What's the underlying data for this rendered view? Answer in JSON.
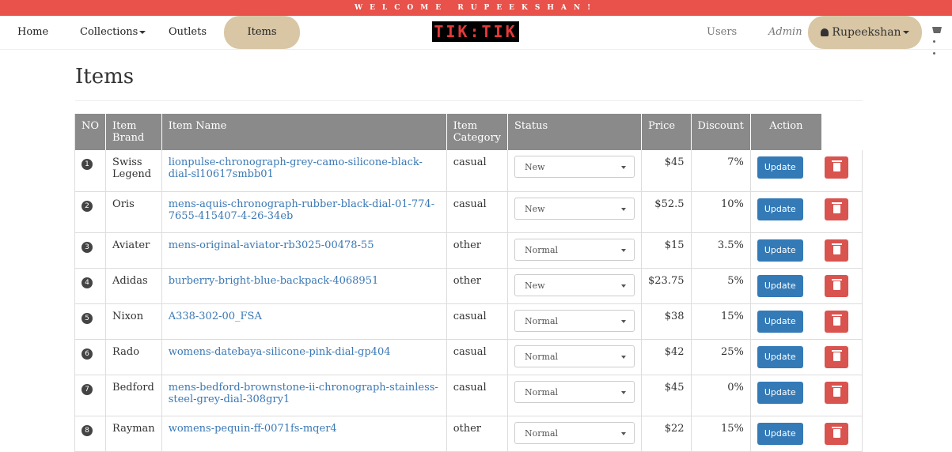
{
  "banner": {
    "text": "WELCOME RUPEEKSHAN!"
  },
  "nav": {
    "home": "Home",
    "collections": "Collections",
    "outlets": "Outlets",
    "items": "Items",
    "logo": "TIK:TIK",
    "users": "Users",
    "admin": "Admin",
    "user_name": "Rupeekshan"
  },
  "page": {
    "title": "Items"
  },
  "table": {
    "headers": {
      "no": "NO",
      "brand": "Item Brand",
      "name": "Item Name",
      "category": "Item Category",
      "status": "Status",
      "price": "Price",
      "discount": "Discount",
      "action": "Action"
    },
    "update_label": "Update",
    "rows": [
      {
        "no": "1",
        "brand": "Swiss Legend",
        "name": "lionpulse-chronograph-grey-camo-silicone-black-dial-sl10617smbb01",
        "category": "casual",
        "status": "New",
        "price": "$45",
        "discount": "7%"
      },
      {
        "no": "2",
        "brand": "Oris",
        "name": "mens-aquis-chronograph-rubber-black-dial-01-774-7655-415407-4-26-34eb",
        "category": "casual",
        "status": "New",
        "price": "$52.5",
        "discount": "10%"
      },
      {
        "no": "3",
        "brand": "Aviater",
        "name": "mens-original-aviator-rb3025-00478-55",
        "category": "other",
        "status": "Normal",
        "price": "$15",
        "discount": "3.5%"
      },
      {
        "no": "4",
        "brand": "Adidas",
        "name": "burberry-bright-blue-backpack-4068951",
        "category": "other",
        "status": "New",
        "price": "$23.75",
        "discount": "5%"
      },
      {
        "no": "5",
        "brand": "Nixon",
        "name": "A338-302-00_FSA",
        "category": "casual",
        "status": "Normal",
        "price": "$38",
        "discount": "15%"
      },
      {
        "no": "6",
        "brand": "Rado",
        "name": "womens-datebaya-silicone-pink-dial-gp404",
        "category": "casual",
        "status": "Normal",
        "price": "$42",
        "discount": "25%"
      },
      {
        "no": "7",
        "brand": "Bedford",
        "name": "mens-bedford-brownstone-ii-chronograph-stainless-steel-grey-dial-308gry1",
        "category": "casual",
        "status": "Normal",
        "price": "$45",
        "discount": "0%"
      },
      {
        "no": "8",
        "brand": "Rayman",
        "name": "womens-pequin-ff-0071fs-mqer4",
        "category": "other",
        "status": "Normal",
        "price": "$22",
        "discount": "15%"
      }
    ]
  }
}
